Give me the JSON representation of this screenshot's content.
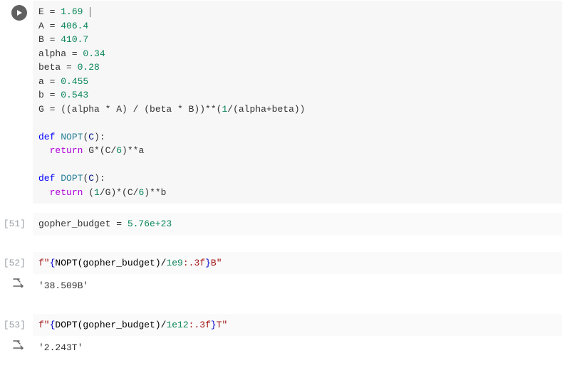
{
  "cells": {
    "c0": {
      "lines": {
        "l0": {
          "pre": "E = ",
          "num": "1.69"
        },
        "l1": {
          "pre": "A = ",
          "num": "406.4"
        },
        "l2": {
          "pre": "B = ",
          "num": "410.7"
        },
        "l3": {
          "pre": "alpha = ",
          "num": "0.34"
        },
        "l4": {
          "pre": "beta = ",
          "num": "0.28"
        },
        "l5": {
          "pre": "a = ",
          "num": "0.455"
        },
        "l6": {
          "pre": "b = ",
          "num": "0.543"
        },
        "l7": {
          "lhs": "G = ((alpha * A) / (beta * B))**(",
          "n1": "1",
          "mid": "/(alpha+beta))"
        },
        "l8": "",
        "l9": {
          "kw": "def",
          "sp": " ",
          "name": "NOPT",
          "open": "(",
          "arg": "C",
          "close": "):"
        },
        "l10": {
          "indent": "  ",
          "kw": "return",
          "body_a": " G*(C/",
          "n6": "6",
          "body_b": ")**a"
        },
        "l11": "",
        "l12": {
          "kw": "def",
          "sp": " ",
          "name": "DOPT",
          "open": "(",
          "arg": "C",
          "close": "):"
        },
        "l13": {
          "indent": "  ",
          "kw": "return",
          "body_a": " (",
          "n1": "1",
          "body_b": "/G)*(C/",
          "n6": "6",
          "body_c": ")**b"
        }
      }
    },
    "c1": {
      "prompt": "[51]",
      "lhs": "gopher_budget = ",
      "num": "5.76e+23"
    },
    "c2": {
      "prompt": "[52]",
      "f_open": "f\"",
      "brace_open": "{",
      "expr_a": "NOPT(gopher_budget)/",
      "expr_num": "1e9",
      "expr_fmt": ":.3f",
      "brace_close": "}",
      "suffix": "B",
      "f_close": "\"",
      "output": "'38.509B'"
    },
    "c3": {
      "prompt": "[53]",
      "f_open": "f\"",
      "brace_open": "{",
      "expr_a": "DOPT(gopher_budget)/",
      "expr_num": "1e12",
      "expr_fmt": ":.3f",
      "brace_close": "}",
      "suffix": "T",
      "f_close": "\"",
      "output": "'2.243T'"
    }
  }
}
